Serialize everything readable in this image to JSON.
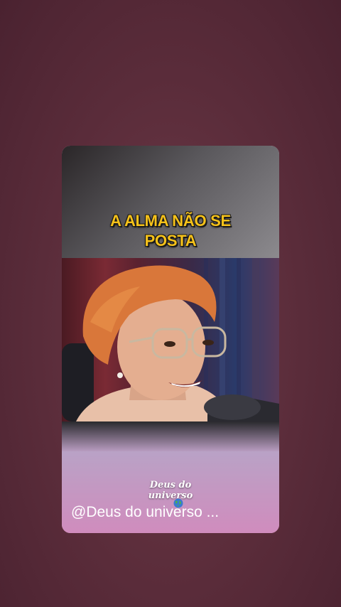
{
  "caption": {
    "line1": "A ALMA NÃO SE",
    "line2": "POSTA"
  },
  "brand": {
    "line1": "Deus do",
    "line2": "universo"
  },
  "handle": {
    "text": "@Deus do universo ..."
  },
  "icons": {
    "globe": "globe-icon"
  },
  "colors": {
    "background": "#5a2c3a",
    "caption_text": "#f6c21a",
    "card_lower": "#d08cbd"
  }
}
